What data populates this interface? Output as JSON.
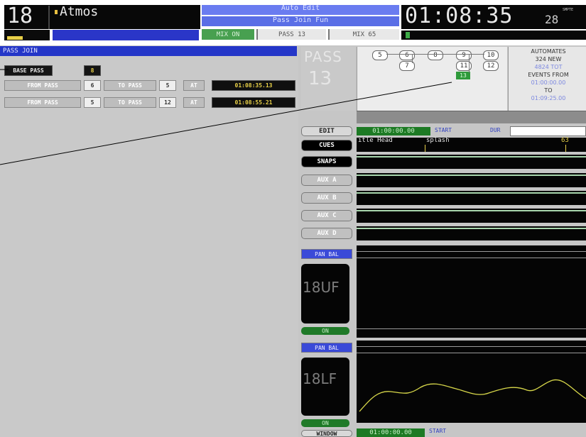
{
  "header": {
    "track_number": "18",
    "track_name": "Atmos",
    "mode_title": "Auto Edit",
    "mode_subtitle": "Pass Join Fun",
    "mix_on": "MIX ON",
    "pass_label": "PASS 13",
    "mix_value": "MIX 65",
    "timecode": "01:08:35",
    "timecode_frames": "28",
    "timecode_unit": "SMPTE"
  },
  "left_panel": {
    "title": "PASS JOIN",
    "base_pass_label": "BASE PASS",
    "base_pass_value": "8",
    "rows": [
      {
        "from_label": "FROM PASS",
        "from": "6",
        "to_label": "TO PASS",
        "to": "5",
        "at_label": "AT",
        "time": "01:08:35.13"
      },
      {
        "from_label": "FROM PASS",
        "from": "5",
        "to_label": "TO PASS",
        "to": "12",
        "at_label": "AT",
        "time": "01:08:55.21"
      }
    ]
  },
  "pass_tree": {
    "pass_title": "PASS",
    "pass_number": "13",
    "nodes": [
      "5",
      "6",
      "8",
      "9",
      "10",
      "7",
      "11",
      "12",
      "13"
    ],
    "current_node": "13"
  },
  "info": {
    "line1": "AUTOMATES",
    "line2": "324 NEW",
    "line3": "4824 TOT",
    "line4": "EVENTS FROM",
    "line5": "01:00:00.00",
    "line6": "TO",
    "line7": "01:09:25.00"
  },
  "timeline": {
    "time": "01:00:00.00",
    "start_label": "START",
    "dur_label": "DUR",
    "cue1": "itle Head",
    "cue2": "splash",
    "cue3": "63",
    "bottom_time": "01:00:00.00",
    "bottom_start": "START"
  },
  "side_buttons": {
    "edit": "EDIT",
    "cues": "CUES",
    "snaps": "SNAPS",
    "aux_a": "AUX A",
    "aux_b": "AUX B",
    "aux_c": "AUX C",
    "aux_d": "AUX D",
    "pan_bal_1": "PAN BAL",
    "channel_1": "18UF",
    "on_1": "ON",
    "pan_bal_2": "PAN BAL",
    "channel_2": "18LF",
    "on_2": "ON",
    "window": "WINDOW"
  }
}
